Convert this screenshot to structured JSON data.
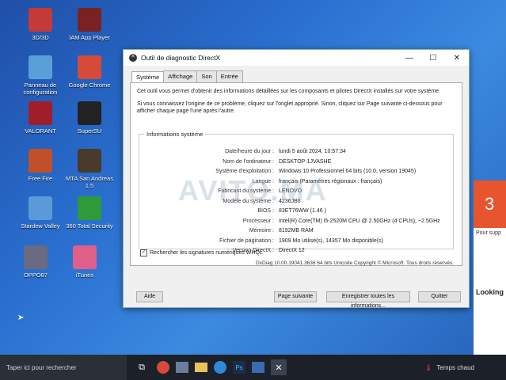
{
  "desktop_icons": [
    {
      "label": "3D/3D",
      "color": "#c43a3a"
    },
    {
      "label": "IAM App Player",
      "color": "#7a2222"
    },
    {
      "label": "Panneau de configuration",
      "color": "#5aa0d8"
    },
    {
      "label": "Google Chrome",
      "color": "#d64a3a"
    },
    {
      "label": "VALORANT",
      "color": "#a01e2a"
    },
    {
      "label": "SuperSU",
      "color": "#222222"
    },
    {
      "label": "Free Fire",
      "color": "#c0502a"
    },
    {
      "label": "MTA San Andreas 1.5",
      "color": "#4a3a2a"
    },
    {
      "label": "Stardew Valley",
      "color": "#5a9ad8"
    },
    {
      "label": "360 Total Security",
      "color": "#2e9a3a"
    },
    {
      "label": "OPPO87",
      "color": "#6a6a80"
    },
    {
      "label": "iTunes",
      "color": "#e0608a"
    }
  ],
  "window": {
    "title": "Outil de diagnostic DirectX",
    "tabs": [
      "Système",
      "Affichage",
      "Son",
      "Entrée"
    ],
    "intro": "Cet outil vous permet d'obtenir des informations détaillées sur les composants et pilotes DirectX installés sur votre système.",
    "intro2": "Si vous connaissez l'origine de ce problème, cliquez sur l'onglet approprié. Sinon, cliquez sur Page suivante ci-dessous pour afficher chaque page l'une après l'autre.",
    "group_title": "Informations système",
    "rows": [
      {
        "k": "Date/heure du jour :",
        "v": "lundi 5 août 2024, 10:57:34"
      },
      {
        "k": "Nom de l'ordinateur :",
        "v": "DESKTOP-1JVASHE"
      },
      {
        "k": "Système d'exploitation :",
        "v": "Windows 10 Professionnel 64 bits (10.0, version 19045)"
      },
      {
        "k": "Langue :",
        "v": "français (Paramètres régionaux : français)"
      },
      {
        "k": "Fabricant du système :",
        "v": "LENOVO"
      },
      {
        "k": "Modèle du système :",
        "v": "4236JB6"
      },
      {
        "k": "BIOS :",
        "v": "83ET76WW (1.46 )"
      },
      {
        "k": "Processeur :",
        "v": "Intel(R) Core(TM) i5-2520M CPU @ 2.50GHz (4 CPUs), ~2.5GHz"
      },
      {
        "k": "Mémoire :",
        "v": "8192MB RAM"
      },
      {
        "k": "Fichier de pagination :",
        "v": "1909 Mo utilisé(s), 14357 Mo disponible(s)"
      },
      {
        "k": "Version DirectX :",
        "v": "DirectX 12"
      }
    ],
    "checkbox_label": "Rechercher les signatures numériques WHQL",
    "copyright": "DxDiag 10.00.19041.3636 64 bits Unicode Copyright © Microsoft. Tous droits réservés.",
    "buttons": {
      "help": "Aide",
      "next": "Page suivante",
      "save": "Enregistrer toutes les informations...",
      "quit": "Quitter"
    }
  },
  "watermark": "AVITO.MA",
  "widget": {
    "number": "3",
    "text": "Pour supp",
    "headline": "Looking"
  },
  "taskbar": {
    "search_placeholder": "Taper ici pour rechercher",
    "weather": "Temps chaud"
  }
}
